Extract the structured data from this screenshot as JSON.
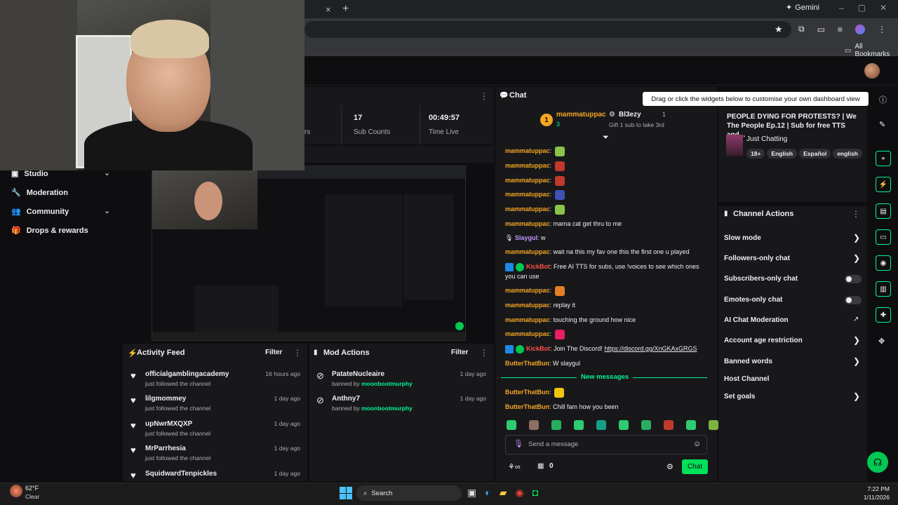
{
  "browser": {
    "tab_close": "×",
    "tab_new": "+",
    "gemini_label": "Gemini",
    "window_controls": [
      "–",
      "▢",
      "✕"
    ],
    "all_bookmarks": "All Bookmarks"
  },
  "sidebar": {
    "items": [
      {
        "label": "Studio",
        "icon": "studio-icon",
        "chevron": "⌄"
      },
      {
        "label": "Moderation",
        "icon": "wrench-icon",
        "chevron": ""
      },
      {
        "label": "Community",
        "icon": "community-icon",
        "chevron": "⌄"
      },
      {
        "label": "Drops & rewards",
        "icon": "gift-icon",
        "chevron": ""
      }
    ]
  },
  "stats": {
    "partial_label": "rs",
    "sub_counts": {
      "value": "17",
      "label": "Sub Counts"
    },
    "time_live": {
      "value": "00:49:57",
      "label": "Time Live"
    }
  },
  "activity_feed": {
    "title": "Activity Feed",
    "filter": "Filter",
    "items": [
      {
        "name": "officialgamblingacademy",
        "action": "just followed the channel",
        "time": "16 hours ago"
      },
      {
        "name": "lilgmommey",
        "action": "just followed the channel",
        "time": "1 day ago"
      },
      {
        "name": "upNwrMXQXP",
        "action": "just followed the channel",
        "time": "1 day ago"
      },
      {
        "name": "MrParrhesia",
        "action": "just followed the channel",
        "time": "1 day ago"
      },
      {
        "name": "SquidwardTenpickles",
        "action": "",
        "time": "1 day ago"
      }
    ]
  },
  "mod_actions": {
    "title": "Mod Actions",
    "filter": "Filter",
    "items": [
      {
        "name": "PatateNucleaire",
        "action_prefix": "banned by ",
        "moderator": "moonbootmurphy",
        "time": "1 day ago"
      },
      {
        "name": "Anthny7",
        "action_prefix": "banned by ",
        "moderator": "moonbootmurphy",
        "time": "1 day ago"
      }
    ]
  },
  "chat": {
    "title": "Chat",
    "leaderboard": [
      {
        "rank": "1",
        "name": "mammatuppac",
        "count": "3"
      },
      {
        "name": "Bl3ezy",
        "note": "Gift 1 sub to take 3rd",
        "count": "1"
      }
    ],
    "messages": [
      {
        "user": "mammatuppac",
        "text": "",
        "emote": "#8bc34a"
      },
      {
        "user": "mammatuppac",
        "text": "",
        "emote": "#c0392b"
      },
      {
        "user": "mammatuppac",
        "text": "",
        "emote": "#c0392b"
      },
      {
        "user": "mammatuppac",
        "text": "",
        "emote": "#3f51b5"
      },
      {
        "user": "mammatuppac",
        "text": "",
        "emote": "#8bc34a"
      },
      {
        "user": "mammatuppac",
        "text": "mama cat get thru to me"
      },
      {
        "user": "Slaygul",
        "text": "w",
        "style": "purple"
      },
      {
        "user": "mammatuppac",
        "text": "wait na this my fav one this the first one u played"
      },
      {
        "user": "KickBot",
        "text": "Free AI TTS for subs, use !voices to see which ones you can use",
        "style": "bot"
      },
      {
        "user": "mammatuppac",
        "text": "",
        "emote": "#e67e22"
      },
      {
        "user": "mammatuppac",
        "text": "replay it"
      },
      {
        "user": "mammatuppac",
        "text": "touching the ground how nice"
      },
      {
        "user": "mammatuppac",
        "text": "",
        "emote": "#e91e63"
      },
      {
        "user": "KickBot",
        "text": "Join The Discord! ",
        "link": "https://discord.gg/XnGKAxGRGS",
        "style": "bot"
      },
      {
        "user": "ButterThatBun",
        "text": "W slaygul"
      }
    ],
    "new_messages": "New messages",
    "after_new": [
      {
        "user": "ButterThatBun",
        "text": "",
        "emote": "#f1c40f"
      },
      {
        "user": "ButterThatBun",
        "text": "Chill fam how you been"
      }
    ],
    "input_placeholder": "Send a message",
    "points": "0",
    "send_label": "Chat"
  },
  "tooltip": "Drag or click the widgets below to customise your own dashboard view",
  "stream_info": {
    "title": "PEOPLE DYING FOR PROTESTS? | We The People Ep.12 | Sub for free TTS and...",
    "category": "Just Chatting",
    "tags": [
      "18+",
      "English",
      "Español",
      "english"
    ]
  },
  "channel_actions": {
    "title": "Channel Actions",
    "items": [
      {
        "label": "Slow mode",
        "control": "chevron"
      },
      {
        "label": "Followers-only chat",
        "control": "chevron"
      },
      {
        "label": "Subscribers-only chat",
        "control": "toggle"
      },
      {
        "label": "Emotes-only chat",
        "control": "toggle"
      },
      {
        "label": "AI Chat Moderation",
        "control": "external"
      },
      {
        "label": "Account age restriction",
        "control": "chevron"
      },
      {
        "label": "Banned words",
        "control": "chevron"
      },
      {
        "label": "Host Channel",
        "control": "none"
      },
      {
        "label": "Set goals",
        "control": "chevron"
      }
    ]
  },
  "taskbar": {
    "weather_temp": "62°F",
    "weather_desc": "Clear",
    "search": "Search",
    "time": "7:22 PM",
    "date": "1/11/2026"
  },
  "colors": {
    "accent_green": "#00f593",
    "chat_user": "#f5a623",
    "panel": "#18181b",
    "bg": "#0e0e10"
  }
}
